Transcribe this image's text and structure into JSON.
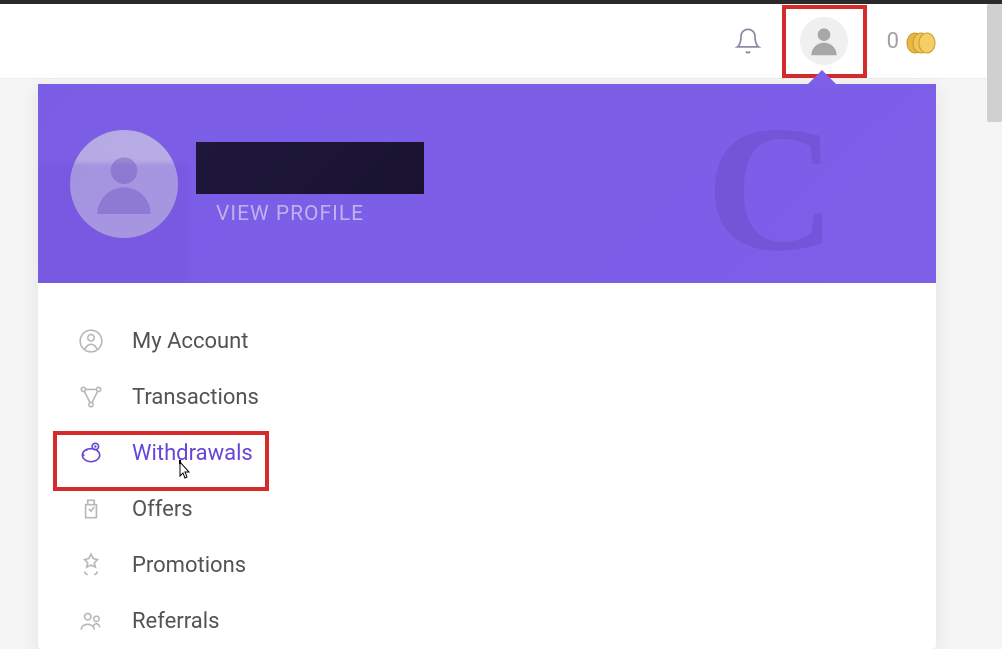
{
  "topbar": {
    "coin_count": "0"
  },
  "profile": {
    "view_profile_label": "VIEW PROFILE",
    "bg_letter": "C"
  },
  "menu": {
    "items": [
      {
        "label": "My Account",
        "icon": "account-icon",
        "active": false
      },
      {
        "label": "Transactions",
        "icon": "transactions-icon",
        "active": false
      },
      {
        "label": "Withdrawals",
        "icon": "withdrawals-icon",
        "active": true
      },
      {
        "label": "Offers",
        "icon": "offers-icon",
        "active": false
      },
      {
        "label": "Promotions",
        "icon": "promotions-icon",
        "active": false
      },
      {
        "label": "Referrals",
        "icon": "referrals-icon",
        "active": false
      }
    ]
  }
}
